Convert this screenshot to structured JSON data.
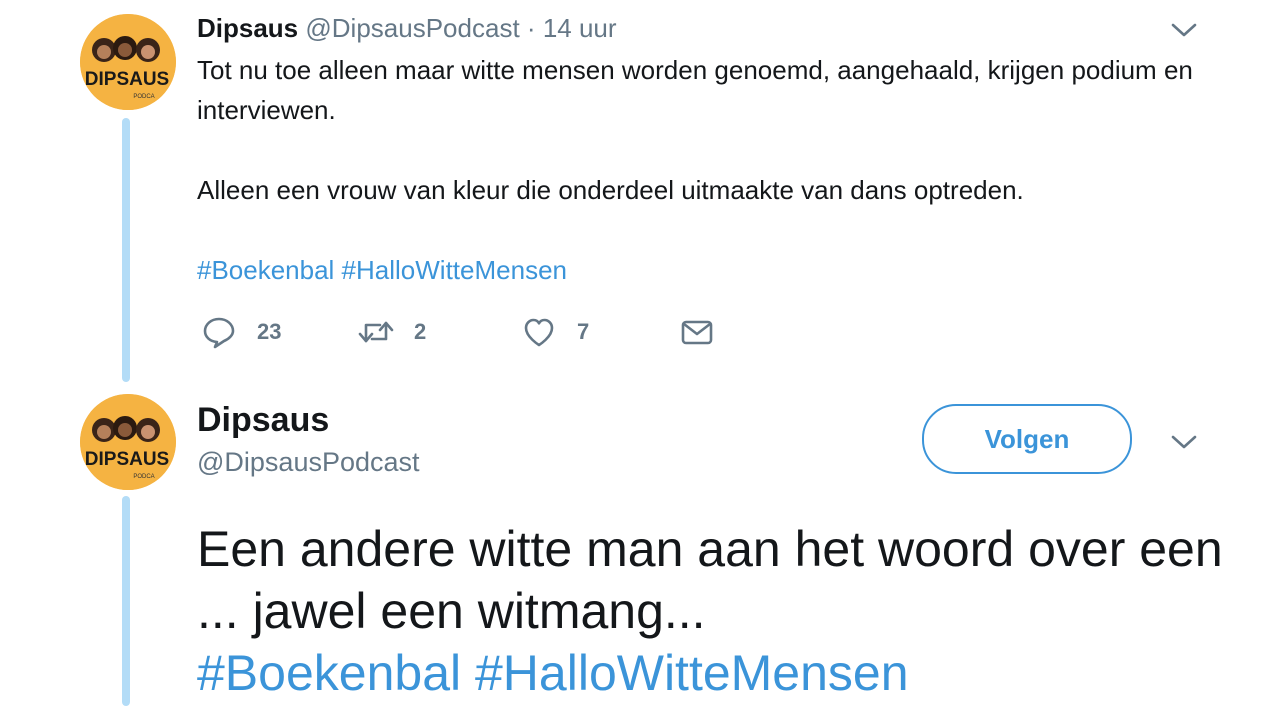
{
  "tweets": [
    {
      "name": "Dipsaus",
      "handle": "@DipsausPodcast",
      "separator": "·",
      "time": "14 uur",
      "paragraphs": [
        "Tot nu toe alleen maar witte mensen worden genoemd, aangehaald, krijgen podium en interviewen.",
        "Alleen een vrouw van kleur die onderdeel uitmaakte van dans optreden."
      ],
      "hashtags": "#Boekenbal #HalloWitteMensen",
      "avatar_text": "DIPSAUS",
      "avatar_subtext": "PODCA",
      "actions": {
        "reply_count": "23",
        "retweet_count": "2",
        "like_count": "7"
      }
    },
    {
      "name": "Dipsaus",
      "handle": "@DipsausPodcast",
      "follow_label": "Volgen",
      "avatar_text": "DIPSAUS",
      "avatar_subtext": "PODCA",
      "text": "Een andere witte man aan het woord over een ... jawel een witmang...",
      "hashtags": "#Boekenbal #HalloWitteMensen"
    }
  ],
  "colors": {
    "accent": "#3b94d9",
    "thread_line": "#b3dcf7",
    "muted": "#657786",
    "avatar_bg": "#f5b342"
  },
  "icons": [
    "reply-icon",
    "retweet-icon",
    "like-icon",
    "message-icon",
    "chevron-down-icon"
  ]
}
